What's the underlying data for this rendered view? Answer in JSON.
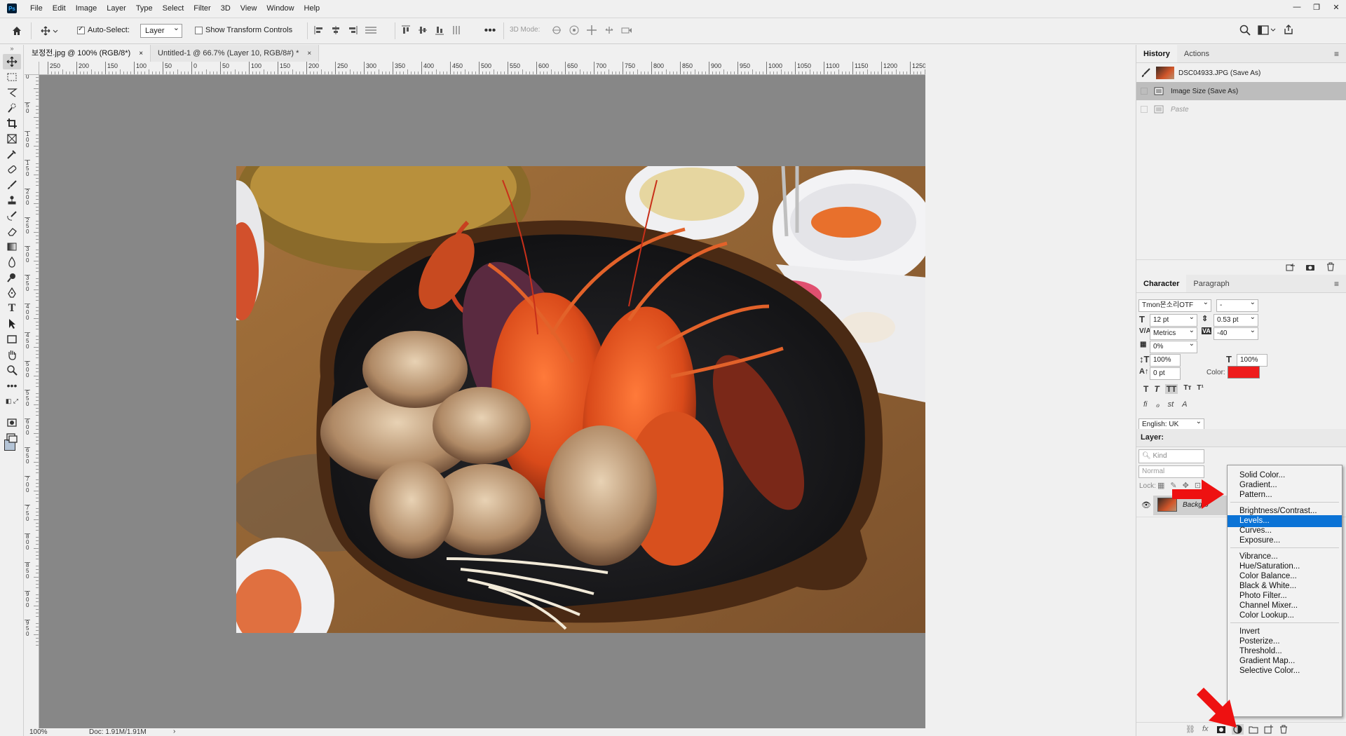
{
  "app": {
    "logo": "Ps"
  },
  "menubar": {
    "items": [
      "File",
      "Edit",
      "Image",
      "Layer",
      "Type",
      "Select",
      "Filter",
      "3D",
      "View",
      "Window",
      "Help"
    ]
  },
  "window_controls": {
    "minimize": "—",
    "restore": "❐",
    "close": "✕"
  },
  "options": {
    "auto_select_label": "Auto-Select:",
    "auto_select_checked": true,
    "auto_select_target": "Layer",
    "show_transform_label": "Show Transform Controls",
    "mode_3d_label": "3D Mode:"
  },
  "tabs": [
    {
      "label": "보정전.jpg @ 100% (RGB/8*)",
      "close": "×"
    },
    {
      "label": "Untitled-1 @ 66.7% (Layer 10, RGB/8#) *",
      "close": "×"
    }
  ],
  "ruler": {
    "h_ticks": [
      "250",
      "200",
      "150",
      "100",
      "50",
      "0",
      "50",
      "100",
      "150",
      "200",
      "250",
      "300",
      "350",
      "400",
      "450",
      "500",
      "550",
      "600",
      "650",
      "700",
      "750",
      "800",
      "850",
      "900",
      "950",
      "1000",
      "1050",
      "1100",
      "1150",
      "1200",
      "1250"
    ],
    "v_ticks": [
      "0",
      "5 0",
      "1 0 0",
      "1 5 0",
      "2 0 0",
      "2 5 0",
      "3 0 0",
      "3 5 0",
      "4 0 0",
      "4 5 0",
      "5 0 0",
      "5 5 0",
      "6 0 0",
      "6 5 0",
      "7 0 0",
      "7 5 0",
      "8 0 0",
      "8 5 0",
      "9 0 0",
      "9 5 0"
    ]
  },
  "status": {
    "zoom": "100%",
    "doc": "Doc: 1.91M/1.91M",
    "arrow": "›"
  },
  "history": {
    "tabs": [
      "History",
      "Actions"
    ],
    "snapshot": "DSC04933.JPG (Save As)",
    "items": [
      {
        "label": "Image Size (Save As)",
        "active": true
      },
      {
        "label": "Paste",
        "active": false
      }
    ]
  },
  "character": {
    "tabs": [
      "Character",
      "Paragraph"
    ],
    "font_family": "Tmon몬소리OTF",
    "font_style": "-",
    "font_size": "12 pt",
    "leading": "0.53 pt",
    "kerning": "Metrics",
    "tracking": "-40",
    "tsume": "0%",
    "vscale": "100%",
    "hscale": "100%",
    "baseline": "0 pt",
    "color_label": "Color:",
    "color": "#ee1c1c",
    "language": "English: UK"
  },
  "layers": {
    "tab": "Layer:",
    "kind": "Kind",
    "blend": "Normal",
    "lock": "Lock:",
    "background_name": "Backgro"
  },
  "menu": {
    "groups": [
      [
        "Solid Color...",
        "Gradient...",
        "Pattern..."
      ],
      [
        "Brightness/Contrast...",
        "Levels...",
        "Curves...",
        "Exposure..."
      ],
      [
        "Vibrance...",
        "Hue/Saturation...",
        "Color Balance...",
        "Black & White...",
        "Photo Filter...",
        "Channel Mixer...",
        "Color Lookup..."
      ],
      [
        "Invert",
        "Posterize...",
        "Threshold...",
        "Gradient Map...",
        "Selective Color..."
      ]
    ],
    "highlighted": "Levels..."
  }
}
